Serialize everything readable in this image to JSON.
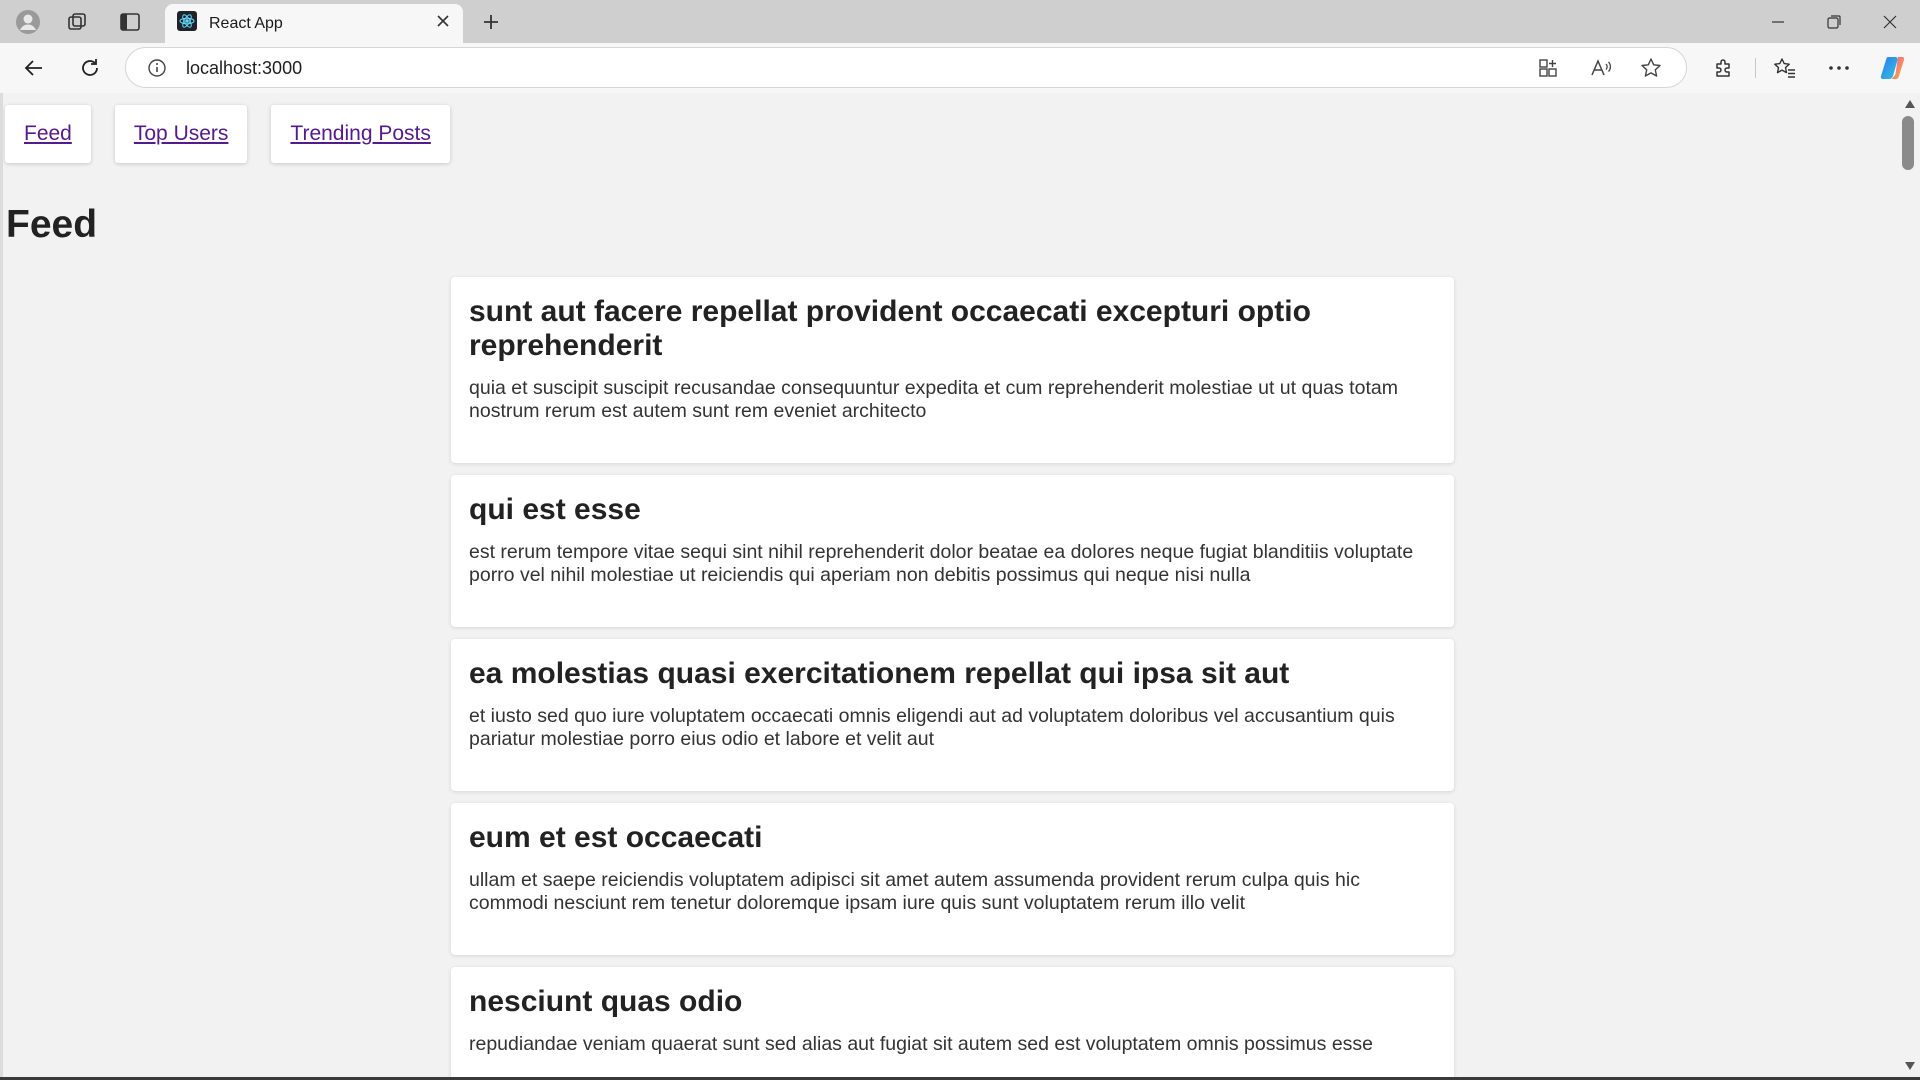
{
  "browser": {
    "tab_title": "React App",
    "address": "localhost:3000"
  },
  "nav": {
    "links": [
      {
        "label": "Feed"
      },
      {
        "label": "Top Users"
      },
      {
        "label": "Trending Posts"
      }
    ]
  },
  "page": {
    "title": "Feed"
  },
  "posts": [
    {
      "title": "sunt aut facere repellat provident occaecati excepturi optio reprehenderit",
      "body": "quia et suscipit suscipit recusandae consequuntur expedita et cum reprehenderit molestiae ut ut quas totam nostrum rerum est autem sunt rem eveniet architecto"
    },
    {
      "title": "qui est esse",
      "body": "est rerum tempore vitae sequi sint nihil reprehenderit dolor beatae ea dolores neque fugiat blanditiis voluptate porro vel nihil molestiae ut reiciendis qui aperiam non debitis possimus qui neque nisi nulla"
    },
    {
      "title": "ea molestias quasi exercitationem repellat qui ipsa sit aut",
      "body": "et iusto sed quo iure voluptatem occaecati omnis eligendi aut ad voluptatem doloribus vel accusantium quis pariatur molestiae porro eius odio et labore et velit aut"
    },
    {
      "title": "eum et est occaecati",
      "body": "ullam et saepe reiciendis voluptatem adipisci sit amet autem assumenda provident rerum culpa quis hic commodi nesciunt rem tenetur doloremque ipsam iure quis sunt voluptatem rerum illo velit"
    },
    {
      "title": "nesciunt quas odio",
      "body": "repudiandae veniam quaerat sunt sed alias aut fugiat sit autem sed est voluptatem omnis possimus esse"
    }
  ],
  "icons": {
    "profile": "profile-icon",
    "workspaces": "workspaces-icon",
    "tab_actions": "tab-actions-icon",
    "favicon": "react-logo-icon",
    "close_tab": "close-icon",
    "new_tab": "plus-icon",
    "back": "back-arrow-icon",
    "refresh": "refresh-icon",
    "site_info": "info-icon",
    "app_available": "app-icon",
    "read_aloud": "read-aloud-icon",
    "favorite": "star-icon",
    "extensions": "puzzle-icon",
    "favorites": "favorites-icon",
    "more": "more-icon",
    "copilot": "copilot-icon"
  },
  "colors": {
    "link_visited": "#551a8b",
    "page_bg": "#f2f2f2",
    "card_bg": "#ffffff"
  }
}
